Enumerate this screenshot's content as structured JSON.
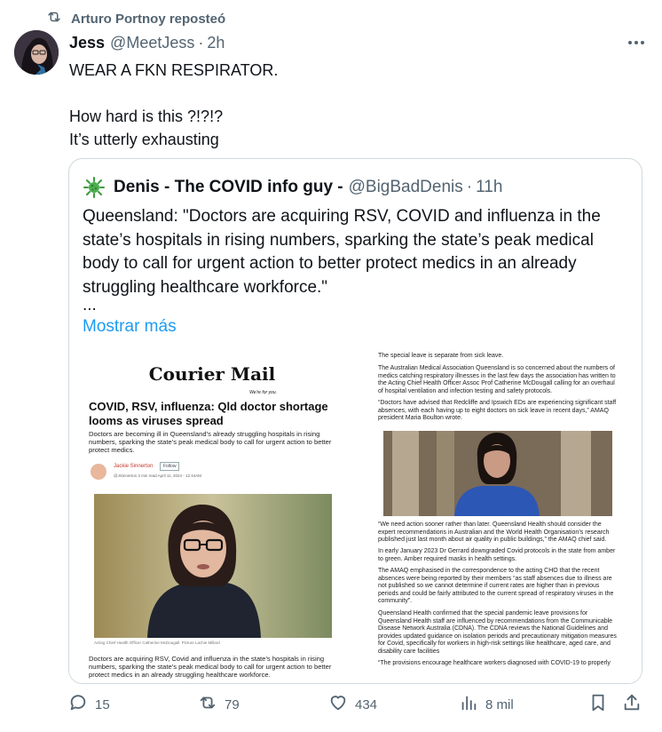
{
  "repost": {
    "text": "Arturo Portnoy reposteó",
    "icon": "repost-icon"
  },
  "tweet": {
    "author_name": "Jess",
    "author_handle": "@MeetJess",
    "separator": "·",
    "time": "2h",
    "text": "WEAR A FKN RESPIRATOR.\n\nHow hard is this ?!?!?\nIt’s utterly exhausting"
  },
  "quote": {
    "author_name": "Denis - The COVID info guy -",
    "author_handle": "@BigBadDenis",
    "separator": "·",
    "time": "11h",
    "text": "Queensland: \"Doctors are acquiring RSV, COVID and influenza in the state’s hospitals in rising numbers, sparking the state’s peak medical body to call for urgent action to better protect medics in an already struggling healthcare workforce.\"",
    "ellipsis": "...",
    "show_more": "Mostrar más"
  },
  "article": {
    "logo": "Courier Mail",
    "logo_tagline": "We're for you.",
    "headline": "COVID, RSV, influenza: Qld doctor shortage looms as viruses spread",
    "lede": "Doctors are becoming ill in Queensland’s already struggling hospitals in rising numbers, sparking the state’s peak medical body to call for urgent action to better protect medics.",
    "author": "Jackie Sinnerton",
    "follow": "Follow",
    "meta": "@JSinnerton   3 min read   April 11, 2024 - 12:44AM",
    "caption": "Acting Chief Health Officer Catherine McDougall. Picture Lachie Millard",
    "bottom_text": "Doctors are acquiring RSV, Covid and influenza in the state’s hospitals in rising numbers, sparking the state’s peak medical body to call for urgent action to better protect medics in an already struggling healthcare workforce.",
    "right_paragraphs": [
      "The special leave is separate from sick leave.",
      "The Australian Medical Association Queensland is so concerned about the numbers of medics catching respiratory illnesses in the last few days the association has written to the Acting Chief Health Officer Assoc Prof Catherine McDougall calling for an overhaul of hospital ventilation and infection testing and safety protocols.",
      "“Doctors have advised that Redcliffe and Ipswich EDs are experiencing significant staff absences, with each having up to eight doctors on sick leave in recent days,” AMAQ president Maria Boulton wrote.",
      "“We need action sooner rather than later. Queensland Health should consider the expert recommendations in Australian and the World Health Organisation’s research published just last month about air quality in public buildings,” the AMAQ chief said.",
      "In early January 2023 Dr Gerrard downgraded Covid protocols in the state from amber to green. Amber required masks in health settings.",
      "The AMAQ emphasised in the correspondence to the acting CHO that the recent absences were being reported by their members “as staff absences due to illness are not published so we cannot determine if current rates are higher than in previous periods and could be fairly attributed to the current spread of respiratory viruses in the community”.",
      "Queensland Health confirmed that the special pandemic leave provisions for Queensland Health staff are influenced by recommendations from the Communicable Disease Network Australia (CDNA). The CDNA reviews the National Guidelines and provides updated guidance on isolation periods and precautionary mitigation measures for Covid, specifically for workers in high-risk settings like healthcare, aged care, and disability care facilities",
      "“The provisions encourage healthcare workers diagnosed with COVID-19 to properly"
    ]
  },
  "actions": {
    "replies": "15",
    "reposts": "79",
    "likes": "434",
    "views": "8 mil"
  },
  "colors": {
    "text": "#0f1419",
    "secondary": "#536471",
    "link": "#1d9bf0",
    "border": "#cfd9de"
  }
}
